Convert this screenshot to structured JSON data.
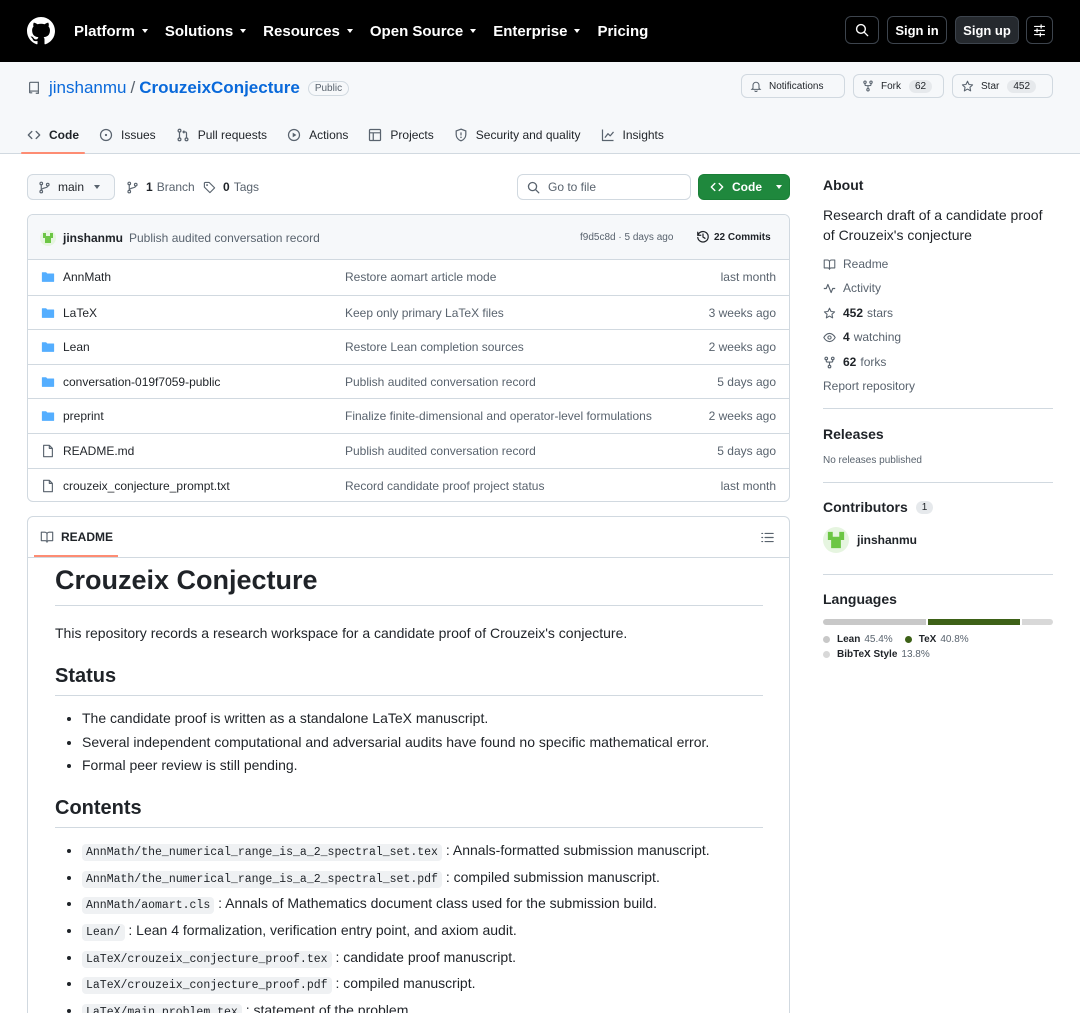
{
  "topnav": {
    "items": [
      "Platform",
      "Solutions",
      "Resources",
      "Open Source",
      "Enterprise",
      "Pricing"
    ],
    "sign_in": "Sign in",
    "sign_up": "Sign up"
  },
  "repo": {
    "owner": "jinshanmu",
    "separator": "/",
    "name": "CrouzeixConjecture",
    "visibility": "Public",
    "notifications_label": "Notifications",
    "fork_label": "Fork",
    "fork_count": "62",
    "star_label": "Star",
    "star_count": "452"
  },
  "tabs": [
    {
      "label": "Code",
      "icon": "code-icon",
      "selected": true
    },
    {
      "label": "Issues",
      "icon": "issue-icon"
    },
    {
      "label": "Pull requests",
      "icon": "pull-request-icon"
    },
    {
      "label": "Actions",
      "icon": "play-icon"
    },
    {
      "label": "Projects",
      "icon": "table-icon"
    },
    {
      "label": "Security and quality",
      "icon": "shield-icon"
    },
    {
      "label": "Insights",
      "icon": "graph-icon"
    }
  ],
  "toolbar": {
    "branch": "main",
    "branch_count": "1",
    "branch_label": "Branch",
    "tag_count": "0",
    "tag_label": "Tags",
    "search_placeholder": "Go to file",
    "code_button": "Code"
  },
  "commit": {
    "author": "jinshanmu",
    "message": "Publish audited conversation record",
    "hash_time": "f9d5c8d · 5 days ago",
    "commits": "22 Commits"
  },
  "files": [
    {
      "name": "AnnMath",
      "type": "folder",
      "message": "Restore aomart article mode",
      "age": "last month"
    },
    {
      "name": "LaTeX",
      "type": "folder",
      "message": "Keep only primary LaTeX files",
      "age": "3 weeks ago"
    },
    {
      "name": "Lean",
      "type": "folder",
      "message": "Restore Lean completion sources",
      "age": "2 weeks ago"
    },
    {
      "name": "conversation-019f7059-public",
      "type": "folder",
      "message": "Publish audited conversation record",
      "age": "5 days ago"
    },
    {
      "name": "preprint",
      "type": "folder",
      "message": "Finalize finite-dimensional and operator-level formulations",
      "age": "2 weeks ago"
    },
    {
      "name": "README.md",
      "type": "file",
      "message": "Publish audited conversation record",
      "age": "5 days ago"
    },
    {
      "name": "crouzeix_conjecture_prompt.txt",
      "type": "file",
      "message": "Record candidate proof project status",
      "age": "last month"
    }
  ],
  "readme": {
    "tab_label": "README",
    "title": "Crouzeix Conjecture",
    "intro": "This repository records a research workspace for a candidate proof of Crouzeix's conjecture.",
    "status_heading": "Status",
    "status_items": [
      "The candidate proof is written as a standalone LaTeX manuscript.",
      "Several independent computational and adversarial audits have found no specific mathematical error.",
      "Formal peer review is still pending."
    ],
    "contents_heading": "Contents",
    "contents_items": [
      {
        "code": "AnnMath/the_numerical_range_is_a_2_spectral_set.tex",
        "text": ": Annals-formatted submission manuscript."
      },
      {
        "code": "AnnMath/the_numerical_range_is_a_2_spectral_set.pdf",
        "text": ": compiled submission manuscript."
      },
      {
        "code": "AnnMath/aomart.cls",
        "text": ": Annals of Mathematics document class used for the submission build."
      },
      {
        "code": "Lean/",
        "text": ": Lean 4 formalization, verification entry point, and axiom audit."
      },
      {
        "code": "LaTeX/crouzeix_conjecture_proof.tex",
        "text": ": candidate proof manuscript."
      },
      {
        "code": "LaTeX/crouzeix_conjecture_proof.pdf",
        "text": ": compiled manuscript."
      },
      {
        "code": "LaTeX/main_problem.tex",
        "text": ": statement of the problem."
      }
    ]
  },
  "about": {
    "heading": "About",
    "description": "Research draft of a candidate proof of Crouzeix's conjecture",
    "readme_link": "Readme",
    "activity_link": "Activity",
    "stars_count": "452",
    "stars_label": "stars",
    "watching_count": "4",
    "watching_label": "watching",
    "forks_count": "62",
    "forks_label": "forks",
    "report_link": "Report repository"
  },
  "releases": {
    "heading": "Releases",
    "text": "No releases published"
  },
  "contributors": {
    "heading": "Contributors",
    "count": "1",
    "user": "jinshanmu"
  },
  "languages": {
    "heading": "Languages",
    "items": [
      {
        "name": "Lean",
        "percent": "45.4%",
        "value": 45.4,
        "color": "#c8c8c8"
      },
      {
        "name": "TeX",
        "percent": "40.8%",
        "value": 40.8,
        "color": "#3d6117"
      },
      {
        "name": "BibTeX Style",
        "percent": "13.8%",
        "value": 13.8,
        "color": "#d8d8d8"
      }
    ]
  },
  "colors": {
    "accent": "#0969da",
    "primary_button": "#1f883d",
    "tab_underline": "#fd8c73"
  }
}
